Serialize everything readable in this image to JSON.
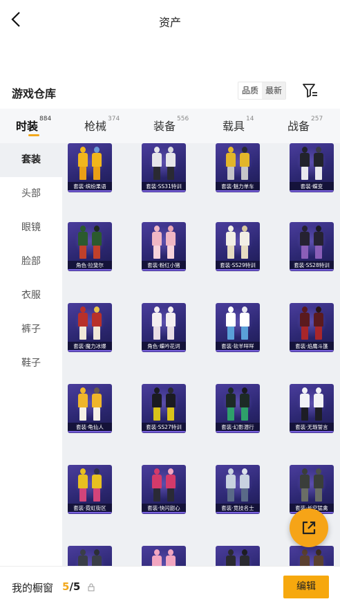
{
  "header": {
    "title": "资产",
    "back_icon": "chevron-left-icon"
  },
  "warehouse": {
    "title": "游戏仓库",
    "sort_options": [
      "品质",
      "最新"
    ],
    "active_sort": "最新",
    "filter_icon": "filter-icon"
  },
  "tabs": [
    {
      "label": "时装",
      "count": "884"
    },
    {
      "label": "枪械",
      "count": "374"
    },
    {
      "label": "装备",
      "count": "556"
    },
    {
      "label": "载具",
      "count": "14"
    },
    {
      "label": "战备",
      "count": "257"
    }
  ],
  "active_tab": "时装",
  "sidebar": {
    "items": [
      "套装",
      "头部",
      "眼镜",
      "脸部",
      "衣服",
      "裤子",
      "鞋子"
    ],
    "active": "套装"
  },
  "items": [
    {
      "label": "套装·缤纷果语"
    },
    {
      "label": "套装·SS31特训"
    },
    {
      "label": "套装·魅力单车"
    },
    {
      "label": "套装·蝶变"
    },
    {
      "label": "角色·拉斐尔"
    },
    {
      "label": "套装·粉红小猪"
    },
    {
      "label": "套装·SS29特训"
    },
    {
      "label": "套装·SS28特训"
    },
    {
      "label": "套装·魔力冰爆"
    },
    {
      "label": "角色·蝶吟花词"
    },
    {
      "label": "套装·软羊咩咩"
    },
    {
      "label": "套装·焰鹰斗篷"
    },
    {
      "label": "套装·龟仙人"
    },
    {
      "label": "套装·SS27特训"
    },
    {
      "label": "套装·幻影潜行"
    },
    {
      "label": "套装·无瑕誓言"
    },
    {
      "label": "套装·霓虹街区"
    },
    {
      "label": "套装·快闪甜心"
    },
    {
      "label": "套装·竞技名士"
    },
    {
      "label": "套装·长空猛禽"
    },
    {
      "label": ""
    },
    {
      "label": ""
    },
    {
      "label": ""
    },
    {
      "label": ""
    }
  ],
  "bottom": {
    "label": "我的橱窗",
    "current": "5",
    "separator": "/",
    "total": "5",
    "edit_label": "编辑",
    "lock_icon": "lock-icon"
  },
  "share_icon": "share-external-icon",
  "colors": {
    "accent": "#f6a80e",
    "card_bg": "#2d2873"
  }
}
